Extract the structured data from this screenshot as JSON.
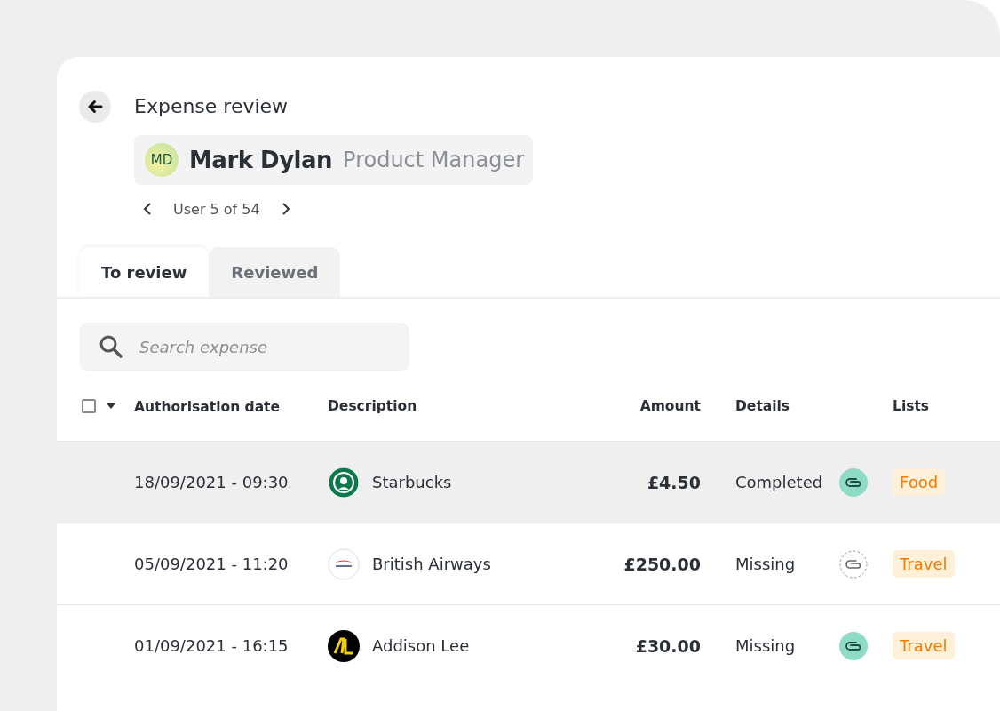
{
  "header": {
    "title": "Expense review",
    "user": {
      "initials": "MD",
      "name": "Mark Dylan",
      "role": "Product Manager"
    },
    "pager": "User 5 of 54"
  },
  "tabs": [
    {
      "label": "To review",
      "selected": true
    },
    {
      "label": "Reviewed",
      "selected": false
    }
  ],
  "search": {
    "placeholder": "Search expense"
  },
  "table": {
    "select_all": {
      "checked": false
    },
    "columns": [
      "Authorisation date",
      "Description",
      "Amount",
      "Details",
      "Lists"
    ],
    "rows": [
      {
        "date": "18/09/2021 - 09:30",
        "kind": "starbucks",
        "description": "Starbucks",
        "amount": "£4.50",
        "details": "Completed",
        "receipt_attached": true,
        "list": "Food",
        "selected": true
      },
      {
        "date": "05/09/2021 - 11:20",
        "kind": "airline",
        "description": "British Airways",
        "amount": "£250.00",
        "details": "Missing",
        "receipt_attached": false,
        "list": "Travel",
        "selected": false
      },
      {
        "date": "01/09/2021 - 16:15",
        "kind": "taxi",
        "description": "Addison Lee",
        "amount": "£30.00",
        "details": "Missing",
        "receipt_attached": true,
        "list": "Travel",
        "selected": false
      }
    ]
  }
}
